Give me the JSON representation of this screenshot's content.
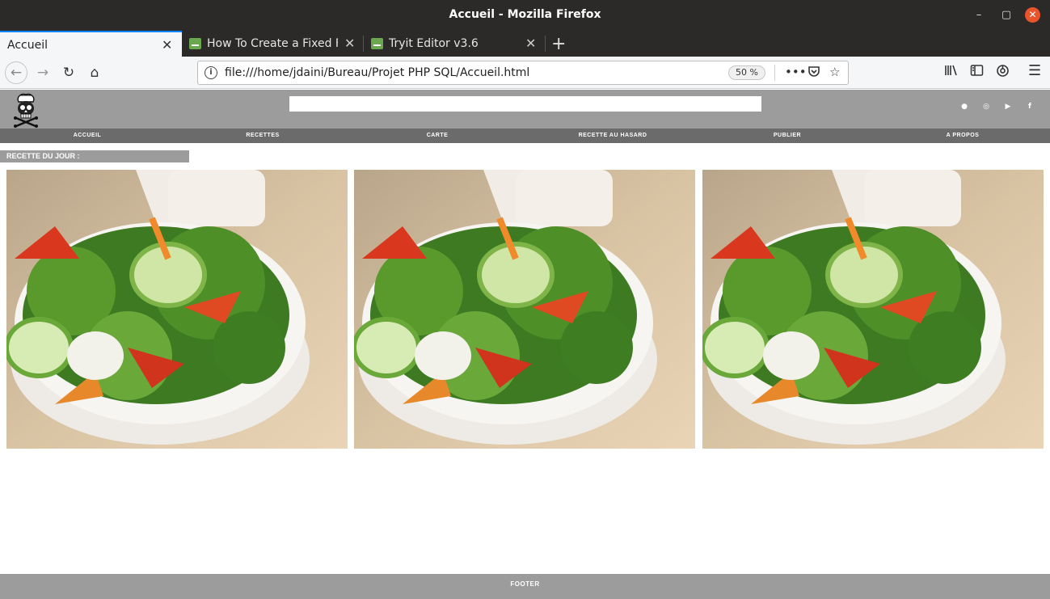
{
  "window": {
    "title": "Accueil - Mozilla Firefox",
    "controls": {
      "minimize": "–",
      "maximize": "▢",
      "close": "✕"
    }
  },
  "tabs": [
    {
      "label": "Accueil",
      "active": true
    },
    {
      "label": "How To Create a Fixed Fo",
      "active": false,
      "icon": "w3schools-favicon"
    },
    {
      "label": "Tryit Editor v3.6",
      "active": false,
      "icon": "w3schools-favicon"
    }
  ],
  "toolbar": {
    "url": "file:///home/jdaini/Bureau/Projet PHP SQL/Accueil.html",
    "zoom": "50 %",
    "icons": [
      "back-icon",
      "forward-icon",
      "reload-icon",
      "home-icon",
      "page-actions-icon",
      "pocket-icon",
      "bookmark-star-icon",
      "library-icon",
      "sidebar-icon",
      "extension-icon",
      "menu-icon"
    ]
  },
  "site": {
    "search_value": "",
    "social_icons": [
      "circle-icon",
      "instagram-icon",
      "youtube-icon",
      "facebook-icon"
    ],
    "social_glyphs": [
      "●",
      "◎",
      "▶",
      "f"
    ],
    "nav": [
      "ACCUEIL",
      "RECETTES",
      "CARTE",
      "RECETTE AU HASARD",
      "PUBLIER",
      "A PROPOS"
    ],
    "day_label": "RECETTE DU JOUR :",
    "dishes": [
      "salad-bowl-image",
      "salad-bowl-image",
      "salad-bowl-image"
    ],
    "footer": "FOOTER"
  },
  "colors": {
    "header_bg": "#9c9c9c",
    "nav_bg": "#6b6b6b",
    "titlebar_bg": "#2b2a28",
    "tab_accent": "#0a84ff"
  }
}
